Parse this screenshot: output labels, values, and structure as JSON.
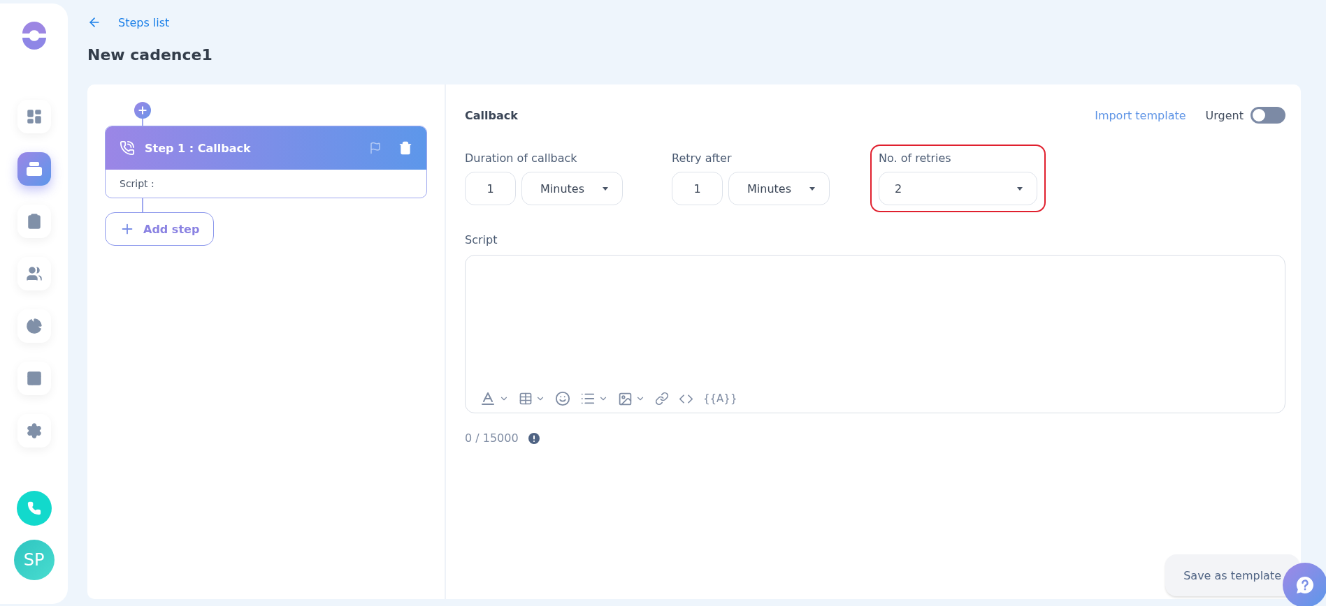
{
  "sidebar": {
    "nav": [
      {
        "selected": false
      },
      {
        "selected": true
      },
      {
        "selected": false
      },
      {
        "selected": false
      },
      {
        "selected": false
      },
      {
        "selected": false
      },
      {
        "selected": false
      }
    ],
    "avatar": "SP"
  },
  "back_link": "Steps list",
  "title": "New cadence1",
  "steps": [
    {
      "title": "Step 1 : Callback",
      "script_label": "Script :"
    }
  ],
  "add_step": "Add step",
  "form": {
    "title": "Callback",
    "import_link": "Import template",
    "urgent": {
      "label": "Urgent",
      "on": false
    },
    "fields": [
      {
        "kind": "duration",
        "label": "Duration of callback",
        "number": "1",
        "unit": "Minutes",
        "highlighted": false
      },
      {
        "kind": "duration",
        "label": "Retry after",
        "number": "1",
        "unit": "Minutes",
        "highlighted": false
      },
      {
        "kind": "select",
        "label": "No. of retries",
        "value": "2",
        "highlighted": true
      }
    ]
  },
  "script": {
    "label": "Script",
    "variable_button": "{{A}}",
    "counter": "0 / 15000"
  },
  "save_button": "Save as template"
}
